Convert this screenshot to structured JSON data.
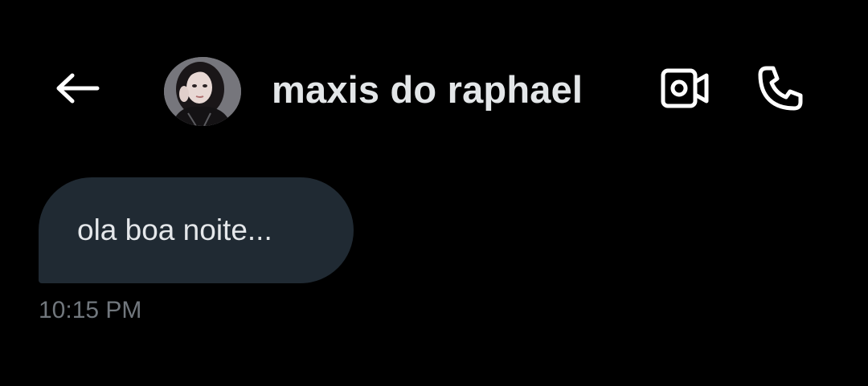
{
  "colors": {
    "background": "#000000",
    "bubble": "#202a33",
    "text_primary": "#e4e7ea",
    "text_secondary": "#71777d",
    "icon": "#ffffff"
  },
  "header": {
    "back_icon": "arrow-left-icon",
    "avatar_alt": "profile photo",
    "contact_name": "maxis do raphael",
    "video_icon": "video-camera-icon",
    "phone_icon": "phone-icon"
  },
  "conversation": {
    "messages": [
      {
        "direction": "incoming",
        "text": "ola boa noite...",
        "time": "10:15 PM"
      }
    ]
  }
}
